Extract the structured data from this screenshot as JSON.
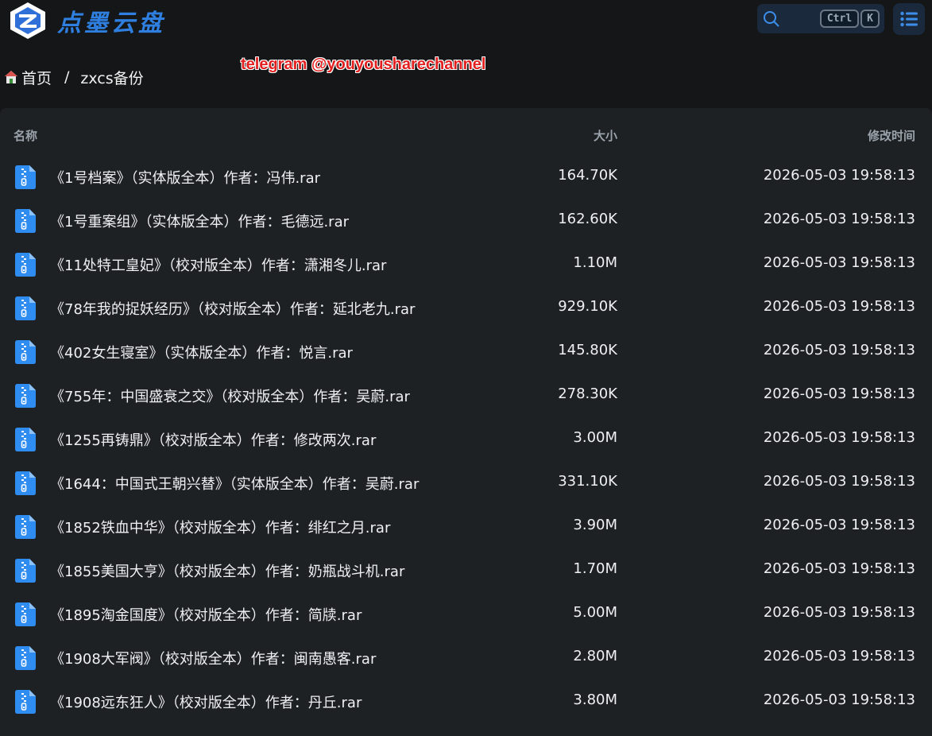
{
  "header": {
    "logo_text": "点墨云盘",
    "search": {
      "kbd_ctrl": "Ctrl",
      "kbd_k": "K"
    }
  },
  "breadcrumb": {
    "home": "首页",
    "separator": "/",
    "current": "zxcs备份"
  },
  "watermark": "telegram @youyousharechannel",
  "columns": {
    "name": "名称",
    "size": "大小",
    "modified": "修改时间"
  },
  "files": [
    {
      "name": "《1号档案》（实体版全本）作者：冯伟.rar",
      "size": "164.70K",
      "modified": "2026-05-03 19:58:13"
    },
    {
      "name": "《1号重案组》（实体版全本）作者：毛德远.rar",
      "size": "162.60K",
      "modified": "2026-05-03 19:58:13"
    },
    {
      "name": "《11处特工皇妃》（校对版全本）作者：潇湘冬儿.rar",
      "size": "1.10M",
      "modified": "2026-05-03 19:58:13"
    },
    {
      "name": "《78年我的捉妖经历》（校对版全本）作者：延北老九.rar",
      "size": "929.10K",
      "modified": "2026-05-03 19:58:13"
    },
    {
      "name": "《402女生寝室》（实体版全本）作者：悦言.rar",
      "size": "145.80K",
      "modified": "2026-05-03 19:58:13"
    },
    {
      "name": "《755年：中国盛衰之交》（校对版全本）作者：吴蔚.rar",
      "size": "278.30K",
      "modified": "2026-05-03 19:58:13"
    },
    {
      "name": "《1255再铸鼎》（校对版全本）作者：修改两次.rar",
      "size": "3.00M",
      "modified": "2026-05-03 19:58:13"
    },
    {
      "name": "《1644：中国式王朝兴替》（实体版全本）作者：吴蔚.rar",
      "size": "331.10K",
      "modified": "2026-05-03 19:58:13"
    },
    {
      "name": "《1852铁血中华》（校对版全本）作者：绯红之月.rar",
      "size": "3.90M",
      "modified": "2026-05-03 19:58:13"
    },
    {
      "name": "《1855美国大亨》（校对版全本）作者：奶瓶战斗机.rar",
      "size": "1.70M",
      "modified": "2026-05-03 19:58:13"
    },
    {
      "name": "《1895淘金国度》（校对版全本）作者：简牍.rar",
      "size": "5.00M",
      "modified": "2026-05-03 19:58:13"
    },
    {
      "name": "《1908大军阀》（校对版全本）作者：闽南愚客.rar",
      "size": "2.80M",
      "modified": "2026-05-03 19:58:13"
    },
    {
      "name": "《1908远东狂人》（校对版全本）作者：丹丘.rar",
      "size": "3.80M",
      "modified": "2026-05-03 19:58:13"
    }
  ],
  "colors": {
    "accent": "#2e7fe0",
    "file_icon": "#2f8cf0",
    "watermark": "#e32020"
  }
}
